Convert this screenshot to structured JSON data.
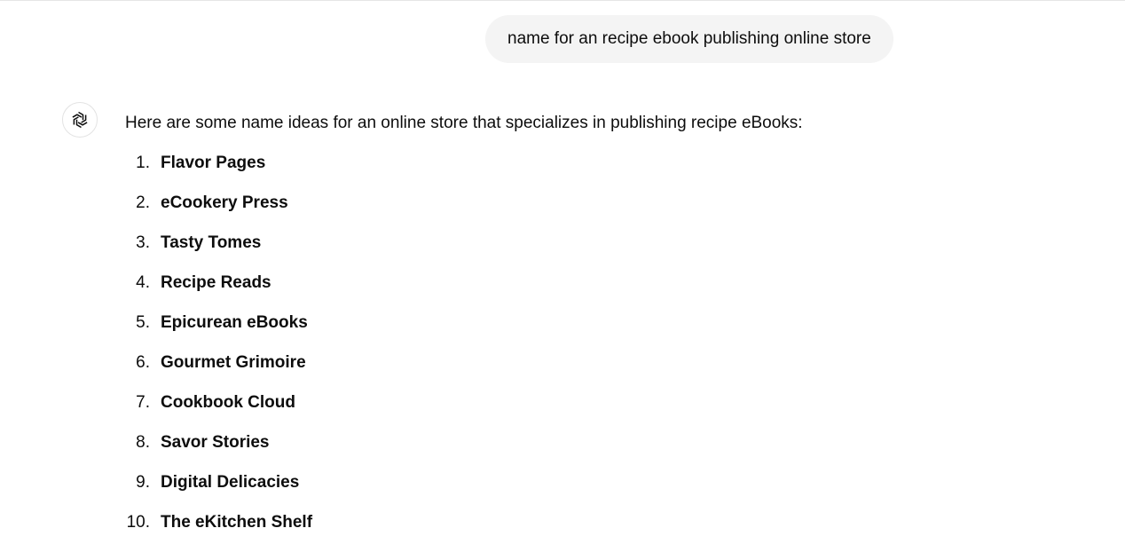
{
  "user_message": {
    "text": "name for an recipe ebook publishing online store"
  },
  "assistant": {
    "avatar_icon": "openai-logo-icon",
    "intro": "Here are some name ideas for an online store that specializes in publishing recipe eBooks:",
    "names": [
      {
        "number": "1.",
        "name": "Flavor Pages"
      },
      {
        "number": "2.",
        "name": "eCookery Press"
      },
      {
        "number": "3.",
        "name": "Tasty Tomes"
      },
      {
        "number": "4.",
        "name": "Recipe Reads"
      },
      {
        "number": "5.",
        "name": "Epicurean eBooks"
      },
      {
        "number": "6.",
        "name": "Gourmet Grimoire"
      },
      {
        "number": "7.",
        "name": "Cookbook Cloud"
      },
      {
        "number": "8.",
        "name": "Savor Stories"
      },
      {
        "number": "9.",
        "name": "Digital Delicacies"
      },
      {
        "number": "10.",
        "name": "The eKitchen Shelf"
      }
    ]
  },
  "colors": {
    "bubble_background": "#f4f4f4",
    "text": "#0d0d0d",
    "border": "#e5e5e5"
  }
}
